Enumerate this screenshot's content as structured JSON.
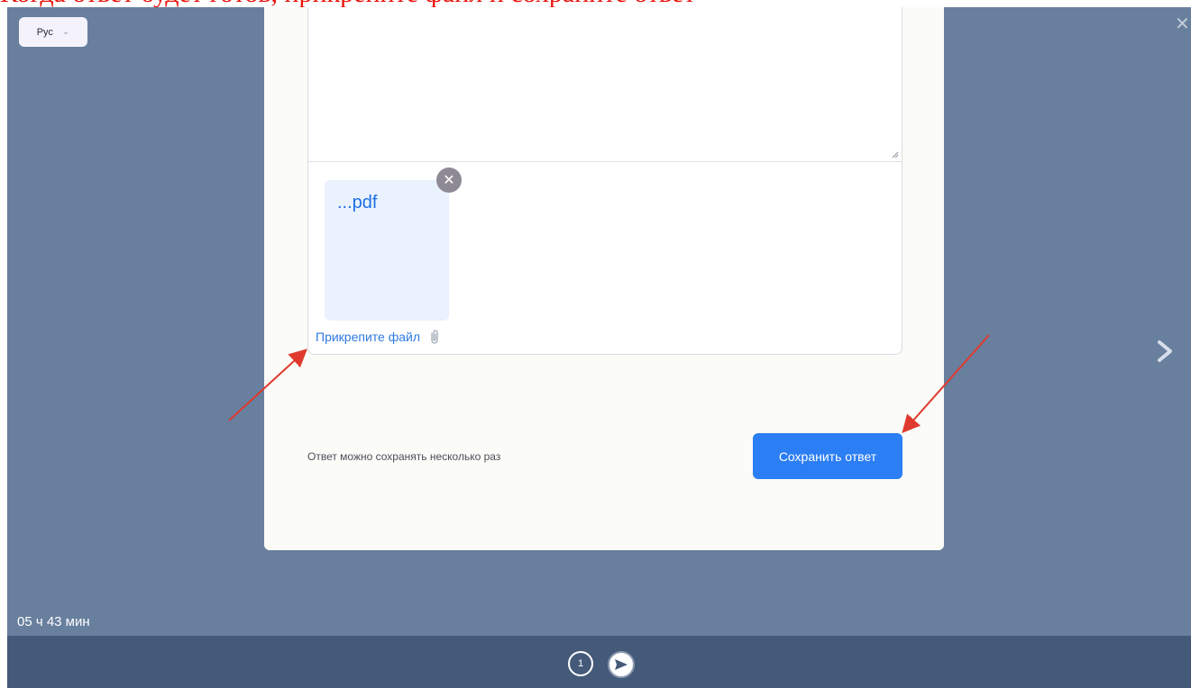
{
  "caption": "Когда ответ будет готов, прикрепите файл и сохраните ответ",
  "language": {
    "selected": "Рус"
  },
  "attachment": {
    "file_name": "...pdf",
    "attach_label": "Прикрепите файл"
  },
  "hint_text": "Ответ можно сохранять несколько раз",
  "save_button_label": "Сохранить ответ",
  "timer": "05 ч 43 мин",
  "steps": [
    {
      "label": "1"
    }
  ],
  "icons": {
    "close": "close-icon",
    "next": "chevron-right-icon",
    "remove": "close-circle-icon",
    "attach": "paperclip-icon",
    "send": "send-icon"
  },
  "colors": {
    "accent": "#2b7ef3",
    "annotation": "#e03a2e",
    "background": "#687f9e",
    "footer": "#455a79"
  }
}
